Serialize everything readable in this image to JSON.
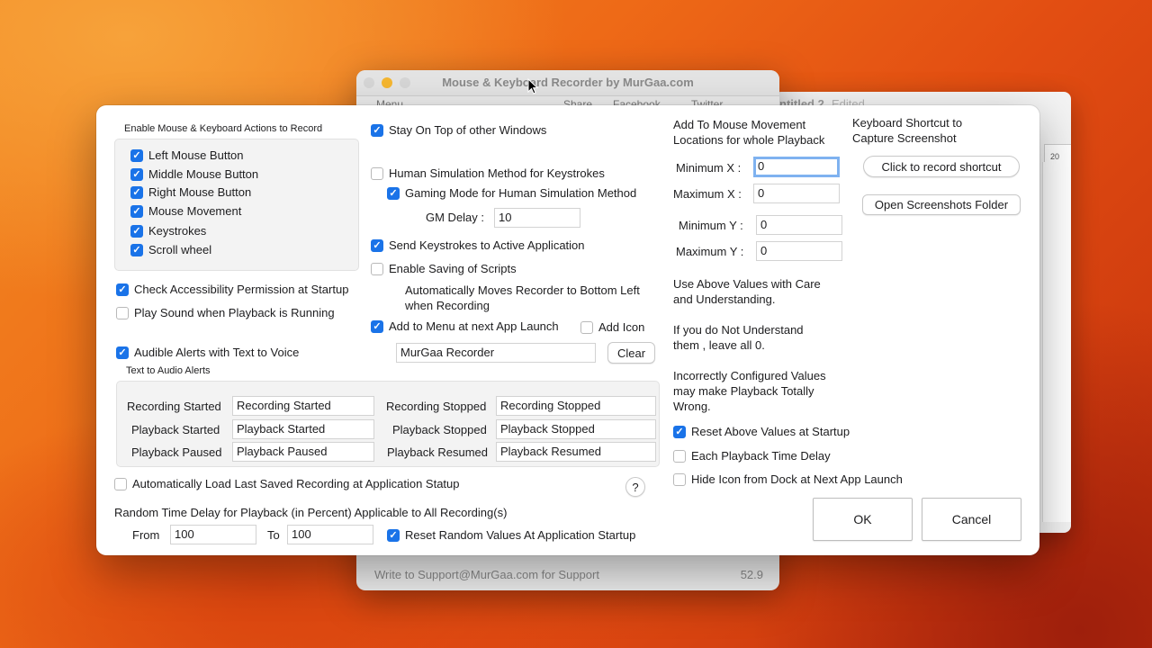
{
  "background_window": {
    "title": "Mouse & Keyboard Recorder by MurGaa.com",
    "toolbar": [
      "Menu",
      "Share",
      "Facebook",
      "Twitter"
    ],
    "status": "Write to Support@MurGaa.com for Support",
    "version": "52.9"
  },
  "background_window2": {
    "title": "ntitled 2",
    "subtitle": "Edited",
    "ruler_value": "20"
  },
  "dialog": {
    "record_group": {
      "heading": "Enable Mouse & Keyboard Actions to Record",
      "items": [
        {
          "label": "Left Mouse Button",
          "checked": true
        },
        {
          "label": "Middle Mouse Button",
          "checked": true
        },
        {
          "label": "Right Mouse Button",
          "checked": true
        },
        {
          "label": "Mouse Movement",
          "checked": true
        },
        {
          "label": "Keystrokes",
          "checked": true
        },
        {
          "label": "Scroll wheel",
          "checked": true
        }
      ]
    },
    "check_accessibility": {
      "label": "Check Accessibility Permission at Startup",
      "checked": true
    },
    "play_sound": {
      "label": "Play Sound when Playback is Running",
      "checked": false
    },
    "audible_alerts": {
      "label": "Audible Alerts with Text to Voice",
      "checked": true
    },
    "text_audio": {
      "heading": "Text to Audio Alerts",
      "rows": [
        {
          "label": "Recording Started",
          "value": "Recording Started"
        },
        {
          "label": "Playback Started",
          "value": "Playback Started"
        },
        {
          "label": "Playback Paused",
          "value": "Playback Paused"
        },
        {
          "label": "Recording Stopped",
          "value": "Recording Stopped"
        },
        {
          "label": "Playback Stopped",
          "value": "Playback Stopped"
        },
        {
          "label": "Playback Resumed",
          "value": "Playback Resumed"
        }
      ]
    },
    "auto_load": {
      "label": "Automatically Load Last Saved Recording at Application Statup",
      "checked": false
    },
    "help_label": "?",
    "random_delay": {
      "heading": "Random Time Delay for Playback (in Percent) Applicable to All Recording(s)",
      "from_label": "From",
      "from_value": "100",
      "to_label": "To",
      "to_value": "100",
      "reset": {
        "label": "Reset Random Values At Application Startup",
        "checked": true
      }
    },
    "middle": {
      "stay_on_top": {
        "label": "Stay On Top of other Windows",
        "checked": true
      },
      "human_sim": {
        "label": "Human Simulation Method for Keystrokes",
        "checked": false
      },
      "gaming_mode": {
        "label": "Gaming Mode for Human Simulation Method",
        "checked": true
      },
      "gm_delay_label": "GM Delay :",
      "gm_delay_value": "10",
      "send_keystrokes": {
        "label": "Send Keystrokes to Active Application",
        "checked": true
      },
      "enable_saving": {
        "label": "Enable Saving of Scripts",
        "checked": false
      },
      "auto_move_text": "Automatically Moves Recorder to Bottom Left when Recording",
      "add_to_menu": {
        "label": "Add to Menu at next App Launch",
        "checked": true
      },
      "add_icon": {
        "label": "Add Icon",
        "checked": false
      },
      "menu_name_value": "MurGaa Recorder",
      "clear_label": "Clear"
    },
    "mouse_locations": {
      "heading": "Add To Mouse Movement Locations for whole Playback",
      "min_x_label": "Minimum X :",
      "min_x_value": "0",
      "max_x_label": "Maximum X :",
      "max_x_value": "0",
      "min_y_label": "Minimum Y :",
      "min_y_value": "0",
      "max_y_label": "Maximum Y :",
      "max_y_value": "0",
      "note1": "Use Above Values with Care and Understanding.",
      "note2": "If you do Not Understand them , leave all 0.",
      "note3": "Incorrectly Configured Values may make Playback Totally Wrong.",
      "reset_values": {
        "label": "Reset Above Values at Startup",
        "checked": true
      },
      "each_delay": {
        "label": "Each Playback Time Delay",
        "checked": false
      },
      "hide_icon": {
        "label": "Hide Icon from Dock at Next App Launch",
        "checked": false
      }
    },
    "screenshot": {
      "heading": "Keyboard Shortcut to Capture Screenshot",
      "record_shortcut_label": "Click to record shortcut",
      "open_folder_label": "Open Screenshots Folder"
    },
    "ok_label": "OK",
    "cancel_label": "Cancel"
  },
  "colors": {
    "accent": "#1a73e8",
    "focus_ring": "#7fb2f0"
  }
}
